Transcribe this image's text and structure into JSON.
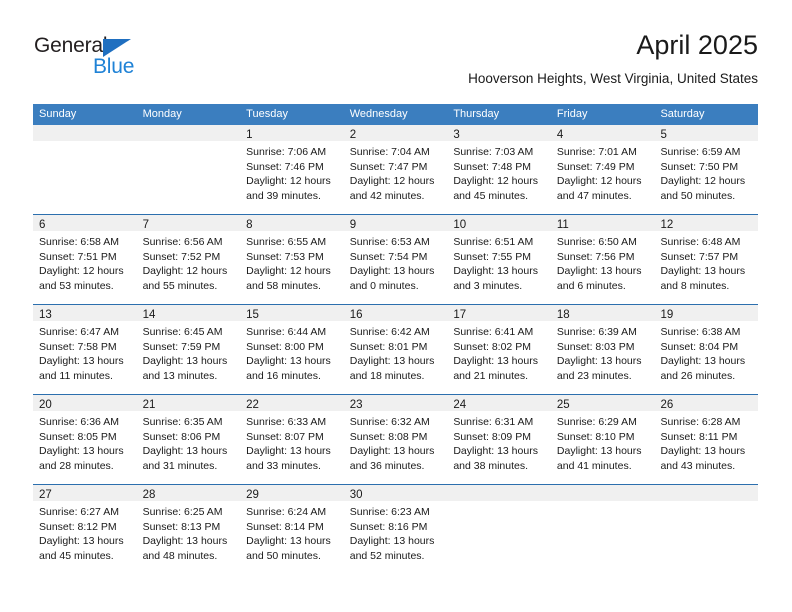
{
  "brand": {
    "name_part1": "General",
    "name_part2": "Blue",
    "accent_color": "#1f82d6",
    "triangle_color": "#1f6fc0"
  },
  "header": {
    "title": "April 2025",
    "subtitle": "Hooverson Heights, West Virginia, United States"
  },
  "calendar": {
    "header_color": "#3b7ebf",
    "row_divider_color": "#2c6fae",
    "day_strip_color": "#f0f0f0",
    "weekdays": [
      "Sunday",
      "Monday",
      "Tuesday",
      "Wednesday",
      "Thursday",
      "Friday",
      "Saturday"
    ],
    "weeks": [
      [
        {
          "day": "",
          "sunrise": "",
          "sunset": "",
          "daylight1": "",
          "daylight2": ""
        },
        {
          "day": "",
          "sunrise": "",
          "sunset": "",
          "daylight1": "",
          "daylight2": ""
        },
        {
          "day": "1",
          "sunrise": "Sunrise: 7:06 AM",
          "sunset": "Sunset: 7:46 PM",
          "daylight1": "Daylight: 12 hours",
          "daylight2": "and 39 minutes."
        },
        {
          "day": "2",
          "sunrise": "Sunrise: 7:04 AM",
          "sunset": "Sunset: 7:47 PM",
          "daylight1": "Daylight: 12 hours",
          "daylight2": "and 42 minutes."
        },
        {
          "day": "3",
          "sunrise": "Sunrise: 7:03 AM",
          "sunset": "Sunset: 7:48 PM",
          "daylight1": "Daylight: 12 hours",
          "daylight2": "and 45 minutes."
        },
        {
          "day": "4",
          "sunrise": "Sunrise: 7:01 AM",
          "sunset": "Sunset: 7:49 PM",
          "daylight1": "Daylight: 12 hours",
          "daylight2": "and 47 minutes."
        },
        {
          "day": "5",
          "sunrise": "Sunrise: 6:59 AM",
          "sunset": "Sunset: 7:50 PM",
          "daylight1": "Daylight: 12 hours",
          "daylight2": "and 50 minutes."
        }
      ],
      [
        {
          "day": "6",
          "sunrise": "Sunrise: 6:58 AM",
          "sunset": "Sunset: 7:51 PM",
          "daylight1": "Daylight: 12 hours",
          "daylight2": "and 53 minutes."
        },
        {
          "day": "7",
          "sunrise": "Sunrise: 6:56 AM",
          "sunset": "Sunset: 7:52 PM",
          "daylight1": "Daylight: 12 hours",
          "daylight2": "and 55 minutes."
        },
        {
          "day": "8",
          "sunrise": "Sunrise: 6:55 AM",
          "sunset": "Sunset: 7:53 PM",
          "daylight1": "Daylight: 12 hours",
          "daylight2": "and 58 minutes."
        },
        {
          "day": "9",
          "sunrise": "Sunrise: 6:53 AM",
          "sunset": "Sunset: 7:54 PM",
          "daylight1": "Daylight: 13 hours",
          "daylight2": "and 0 minutes."
        },
        {
          "day": "10",
          "sunrise": "Sunrise: 6:51 AM",
          "sunset": "Sunset: 7:55 PM",
          "daylight1": "Daylight: 13 hours",
          "daylight2": "and 3 minutes."
        },
        {
          "day": "11",
          "sunrise": "Sunrise: 6:50 AM",
          "sunset": "Sunset: 7:56 PM",
          "daylight1": "Daylight: 13 hours",
          "daylight2": "and 6 minutes."
        },
        {
          "day": "12",
          "sunrise": "Sunrise: 6:48 AM",
          "sunset": "Sunset: 7:57 PM",
          "daylight1": "Daylight: 13 hours",
          "daylight2": "and 8 minutes."
        }
      ],
      [
        {
          "day": "13",
          "sunrise": "Sunrise: 6:47 AM",
          "sunset": "Sunset: 7:58 PM",
          "daylight1": "Daylight: 13 hours",
          "daylight2": "and 11 minutes."
        },
        {
          "day": "14",
          "sunrise": "Sunrise: 6:45 AM",
          "sunset": "Sunset: 7:59 PM",
          "daylight1": "Daylight: 13 hours",
          "daylight2": "and 13 minutes."
        },
        {
          "day": "15",
          "sunrise": "Sunrise: 6:44 AM",
          "sunset": "Sunset: 8:00 PM",
          "daylight1": "Daylight: 13 hours",
          "daylight2": "and 16 minutes."
        },
        {
          "day": "16",
          "sunrise": "Sunrise: 6:42 AM",
          "sunset": "Sunset: 8:01 PM",
          "daylight1": "Daylight: 13 hours",
          "daylight2": "and 18 minutes."
        },
        {
          "day": "17",
          "sunrise": "Sunrise: 6:41 AM",
          "sunset": "Sunset: 8:02 PM",
          "daylight1": "Daylight: 13 hours",
          "daylight2": "and 21 minutes."
        },
        {
          "day": "18",
          "sunrise": "Sunrise: 6:39 AM",
          "sunset": "Sunset: 8:03 PM",
          "daylight1": "Daylight: 13 hours",
          "daylight2": "and 23 minutes."
        },
        {
          "day": "19",
          "sunrise": "Sunrise: 6:38 AM",
          "sunset": "Sunset: 8:04 PM",
          "daylight1": "Daylight: 13 hours",
          "daylight2": "and 26 minutes."
        }
      ],
      [
        {
          "day": "20",
          "sunrise": "Sunrise: 6:36 AM",
          "sunset": "Sunset: 8:05 PM",
          "daylight1": "Daylight: 13 hours",
          "daylight2": "and 28 minutes."
        },
        {
          "day": "21",
          "sunrise": "Sunrise: 6:35 AM",
          "sunset": "Sunset: 8:06 PM",
          "daylight1": "Daylight: 13 hours",
          "daylight2": "and 31 minutes."
        },
        {
          "day": "22",
          "sunrise": "Sunrise: 6:33 AM",
          "sunset": "Sunset: 8:07 PM",
          "daylight1": "Daylight: 13 hours",
          "daylight2": "and 33 minutes."
        },
        {
          "day": "23",
          "sunrise": "Sunrise: 6:32 AM",
          "sunset": "Sunset: 8:08 PM",
          "daylight1": "Daylight: 13 hours",
          "daylight2": "and 36 minutes."
        },
        {
          "day": "24",
          "sunrise": "Sunrise: 6:31 AM",
          "sunset": "Sunset: 8:09 PM",
          "daylight1": "Daylight: 13 hours",
          "daylight2": "and 38 minutes."
        },
        {
          "day": "25",
          "sunrise": "Sunrise: 6:29 AM",
          "sunset": "Sunset: 8:10 PM",
          "daylight1": "Daylight: 13 hours",
          "daylight2": "and 41 minutes."
        },
        {
          "day": "26",
          "sunrise": "Sunrise: 6:28 AM",
          "sunset": "Sunset: 8:11 PM",
          "daylight1": "Daylight: 13 hours",
          "daylight2": "and 43 minutes."
        }
      ],
      [
        {
          "day": "27",
          "sunrise": "Sunrise: 6:27 AM",
          "sunset": "Sunset: 8:12 PM",
          "daylight1": "Daylight: 13 hours",
          "daylight2": "and 45 minutes."
        },
        {
          "day": "28",
          "sunrise": "Sunrise: 6:25 AM",
          "sunset": "Sunset: 8:13 PM",
          "daylight1": "Daylight: 13 hours",
          "daylight2": "and 48 minutes."
        },
        {
          "day": "29",
          "sunrise": "Sunrise: 6:24 AM",
          "sunset": "Sunset: 8:14 PM",
          "daylight1": "Daylight: 13 hours",
          "daylight2": "and 50 minutes."
        },
        {
          "day": "30",
          "sunrise": "Sunrise: 6:23 AM",
          "sunset": "Sunset: 8:16 PM",
          "daylight1": "Daylight: 13 hours",
          "daylight2": "and 52 minutes."
        },
        {
          "day": "",
          "sunrise": "",
          "sunset": "",
          "daylight1": "",
          "daylight2": ""
        },
        {
          "day": "",
          "sunrise": "",
          "sunset": "",
          "daylight1": "",
          "daylight2": ""
        },
        {
          "day": "",
          "sunrise": "",
          "sunset": "",
          "daylight1": "",
          "daylight2": ""
        }
      ]
    ]
  }
}
